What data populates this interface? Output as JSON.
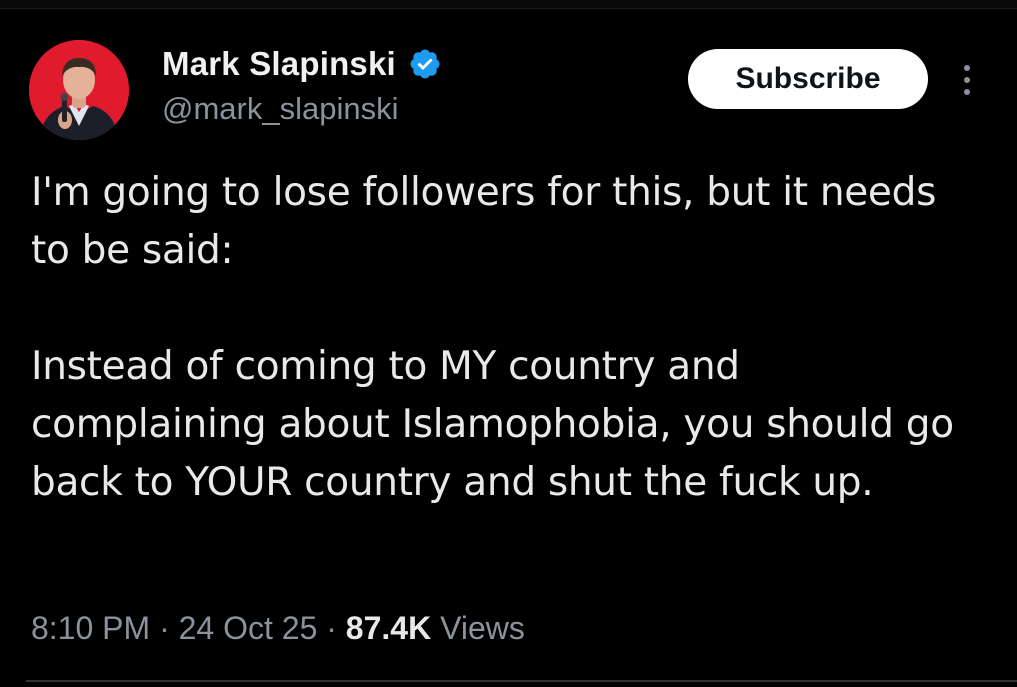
{
  "author": {
    "display_name": "Mark Slapinski",
    "handle": "@mark_slapinski",
    "verified": true,
    "avatar_icon": "profile-photo-avatar"
  },
  "actions": {
    "subscribe_label": "Subscribe",
    "more_icon": "more-vertical-icon"
  },
  "tweet": {
    "paragraphs": [
      "I'm going to lose followers for this, but it needs to be said:",
      "Instead of coming to MY country and complaining about Islamophobia, you should go back to YOUR country and shut the fuck up."
    ]
  },
  "meta": {
    "time": "8:10 PM",
    "separator": "·",
    "date": "24 Oct 25",
    "views_count": "87.4K",
    "views_label": "Views"
  },
  "colors": {
    "background": "#000000",
    "text_primary": "#e7e9ea",
    "text_secondary": "#8b9299",
    "verified_blue": "#1d9bf0",
    "avatar_bg": "#e01b2e"
  }
}
